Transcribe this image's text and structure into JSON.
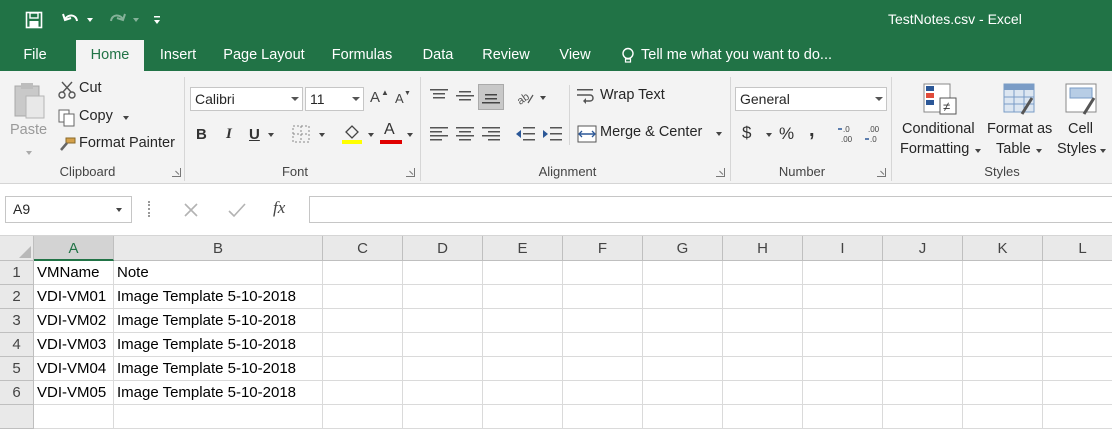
{
  "window": {
    "title": "TestNotes.csv - Excel"
  },
  "tabs": [
    "File",
    "Home",
    "Insert",
    "Page Layout",
    "Formulas",
    "Data",
    "Review",
    "View"
  ],
  "tell_me": "Tell me what you want to do...",
  "clipboard": {
    "paste": "Paste",
    "cut": "Cut",
    "copy": "Copy",
    "format_painter": "Format Painter",
    "label": "Clipboard"
  },
  "font": {
    "name": "Calibri",
    "size": "11",
    "label": "Font",
    "bold": "B",
    "italic": "I",
    "underline": "U"
  },
  "alignment": {
    "wrap_text": "Wrap Text",
    "merge_center": "Merge & Center",
    "label": "Alignment"
  },
  "number": {
    "format": "General",
    "currency": "$",
    "percent": "%",
    "comma": ",",
    "label": "Number"
  },
  "styles": {
    "conditional": "Conditional",
    "formatting": "Formatting",
    "format_as": "Format as",
    "table": "Table",
    "cell": "Cell",
    "cell_styles": "Styles",
    "label": "Styles"
  },
  "formula_bar": {
    "name_box": "A9",
    "fx": "fx",
    "formula": ""
  },
  "columns": [
    "A",
    "B",
    "C",
    "D",
    "E",
    "F",
    "G",
    "H",
    "I",
    "J",
    "K",
    "L"
  ],
  "rows": [
    "1",
    "2",
    "3",
    "4",
    "5",
    "6"
  ],
  "cells": [
    [
      "VMName",
      "Note"
    ],
    [
      "VDI-VM01",
      "Image Template 5-10-2018"
    ],
    [
      "VDI-VM02",
      "Image Template 5-10-2018"
    ],
    [
      "VDI-VM03",
      "Image Template 5-10-2018"
    ],
    [
      "VDI-VM04",
      "Image Template 5-10-2018"
    ],
    [
      "VDI-VM05",
      "Image Template 5-10-2018"
    ]
  ],
  "colors": {
    "brand": "#217346",
    "ribbon": "#f3f3f3"
  }
}
